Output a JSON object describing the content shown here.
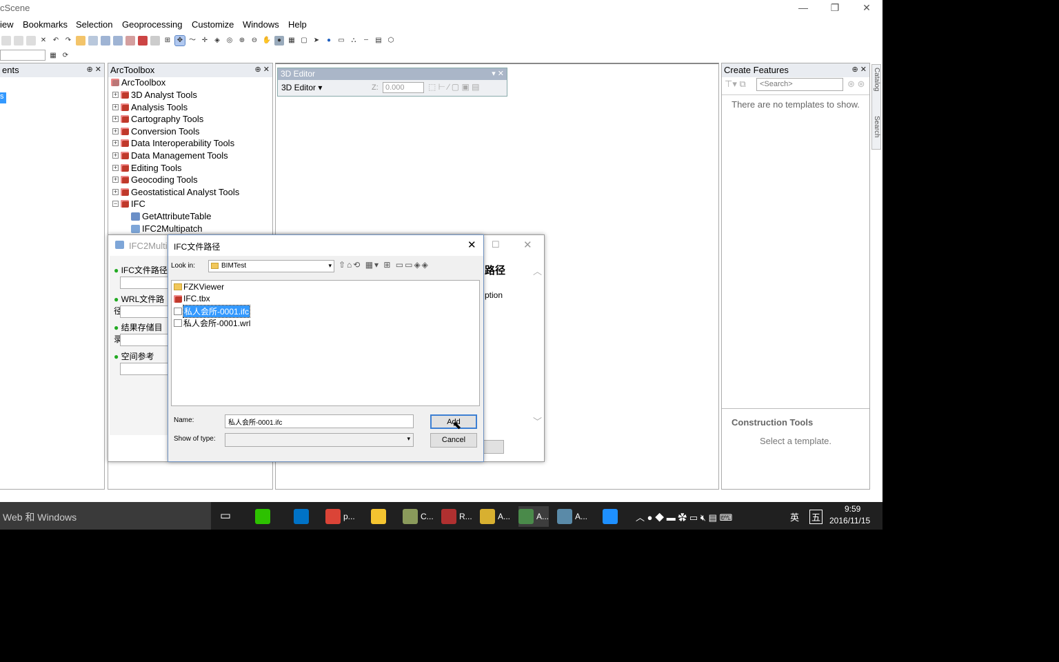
{
  "window": {
    "title": "cScene",
    "min": "—",
    "restore": "❐",
    "close": "✕"
  },
  "menu": [
    "iew",
    "Bookmarks",
    "Selection",
    "Geoprocessing",
    "Customize",
    "Windows",
    "Help"
  ],
  "left_panel": {
    "title": "ents",
    "selected": "s"
  },
  "arctoolbox": {
    "title": "ArcToolbox",
    "root": "ArcToolbox",
    "items": [
      "3D Analyst Tools",
      "Analysis Tools",
      "Cartography Tools",
      "Conversion Tools",
      "Data Interoperability Tools",
      "Data Management Tools",
      "Editing Tools",
      "Geocoding Tools",
      "Geostatistical Analyst Tools",
      "IFC"
    ],
    "children": [
      "GetAttributeTable",
      "IFC2Multipatch"
    ]
  },
  "editor": {
    "title": "3D Editor",
    "menu": "3D Editor ▾",
    "z_label": "Z:",
    "z_value": "0.000"
  },
  "create_features": {
    "title": "Create Features",
    "search_placeholder": "<Search>",
    "empty": "There are no templates to show.",
    "construction_title": "Construction Tools",
    "construction_hint": "Select a template."
  },
  "side_tabs": [
    "Catalog",
    "Search"
  ],
  "tool_dialog": {
    "title": "IFC2Multi",
    "params": [
      "IFC文件路径",
      "WRL文件路径",
      "结果存储目录",
      "空间参考"
    ],
    "help_title": "路径",
    "help_text": "ption"
  },
  "file_dialog": {
    "title": "IFC文件路径",
    "look_in_label": "Look in:",
    "look_in_value": "BIMTest",
    "files": [
      {
        "name": "FZKViewer",
        "type": "folder"
      },
      {
        "name": "IFC.tbx",
        "type": "toolbox"
      },
      {
        "name": "私人会所-0001.ifc",
        "type": "file",
        "selected": true
      },
      {
        "name": "私人会所-0001.wrl",
        "type": "file"
      }
    ],
    "name_label": "Name:",
    "name_value": "私人会所-0001.ifc",
    "type_label": "Show of type:",
    "add_label": "Add",
    "cancel_label": "Cancel"
  },
  "taskbar": {
    "search": "Web 和 Windows",
    "apps": [
      {
        "label": "",
        "icon": "wechat-icon",
        "color": "#2dc100"
      },
      {
        "label": "",
        "icon": "outlook-icon",
        "color": "#0072c6"
      },
      {
        "label": "p...",
        "icon": "chrome-icon",
        "color": "#db4437"
      },
      {
        "label": "",
        "icon": "explorer-icon",
        "color": "#f4c430"
      },
      {
        "label": "C...",
        "icon": "arccatalog-icon",
        "color": "#8a9a5b"
      },
      {
        "label": "R...",
        "icon": "arcreader-icon",
        "color": "#b03030"
      },
      {
        "label": "A...",
        "icon": "arcmap-icon",
        "color": "#d8b030"
      },
      {
        "label": "A...",
        "icon": "arcscene-icon",
        "color": "#4a8a4a"
      },
      {
        "label": "A...",
        "icon": "arcglobe-icon",
        "color": "#5a8aa8"
      },
      {
        "label": "",
        "icon": "ie-icon",
        "color": "#1e90ff"
      }
    ],
    "ime": "英",
    "ime2": "五",
    "time": "9:59",
    "date": "2016/11/15"
  }
}
